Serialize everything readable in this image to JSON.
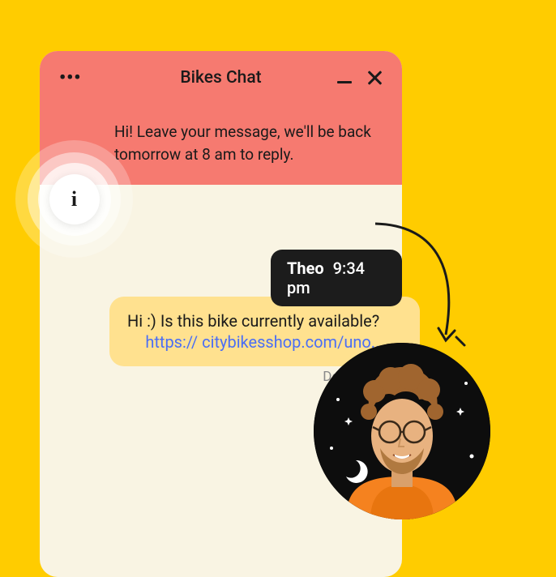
{
  "window": {
    "title": "Bikes Chat"
  },
  "greeting": {
    "text": "Hi! Leave your message, we'll be back tomorrow at 8 am to reply."
  },
  "info_icon_glyph": "i",
  "sender": {
    "name": "Theo",
    "time": "9:34 pm"
  },
  "message": {
    "text": "Hi :) Is this bike currently available?",
    "link": "https:// citybikesshop.com/uno..."
  },
  "status": "Delivered"
}
